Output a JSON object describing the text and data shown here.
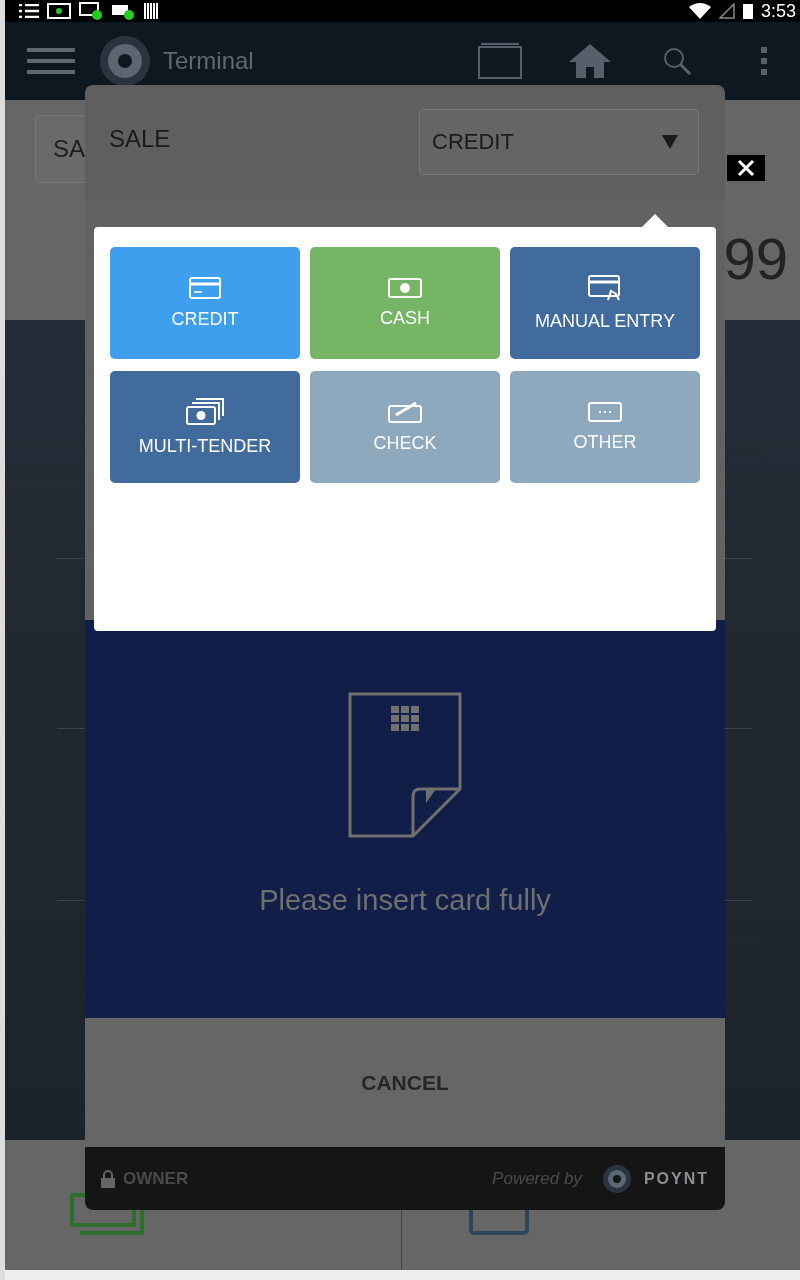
{
  "status_bar": {
    "time": "3:53"
  },
  "app_bar": {
    "title": "Terminal"
  },
  "background": {
    "sale_field": "SA",
    "amount": "99"
  },
  "dialog": {
    "title": "SALE",
    "tender_select": {
      "value": "CREDIT"
    },
    "tender_options": [
      {
        "label": "CREDIT",
        "kind": "credit",
        "color": "#3f9fef"
      },
      {
        "label": "CASH",
        "kind": "cash",
        "color": "#75b565"
      },
      {
        "label": "MANUAL ENTRY",
        "kind": "manual",
        "color": "#416b9c"
      },
      {
        "label": "MULTI-TENDER",
        "kind": "multi",
        "color": "#416b9c"
      },
      {
        "label": "CHECK",
        "kind": "check",
        "color": "#8ea8bd"
      },
      {
        "label": "OTHER",
        "kind": "other",
        "color": "#8ea8bd"
      }
    ],
    "message": "Please insert card fully",
    "cancel": "CANCEL",
    "footer": {
      "user": "OWNER",
      "powered_by": "Powered by",
      "brand": "POYNT"
    }
  }
}
